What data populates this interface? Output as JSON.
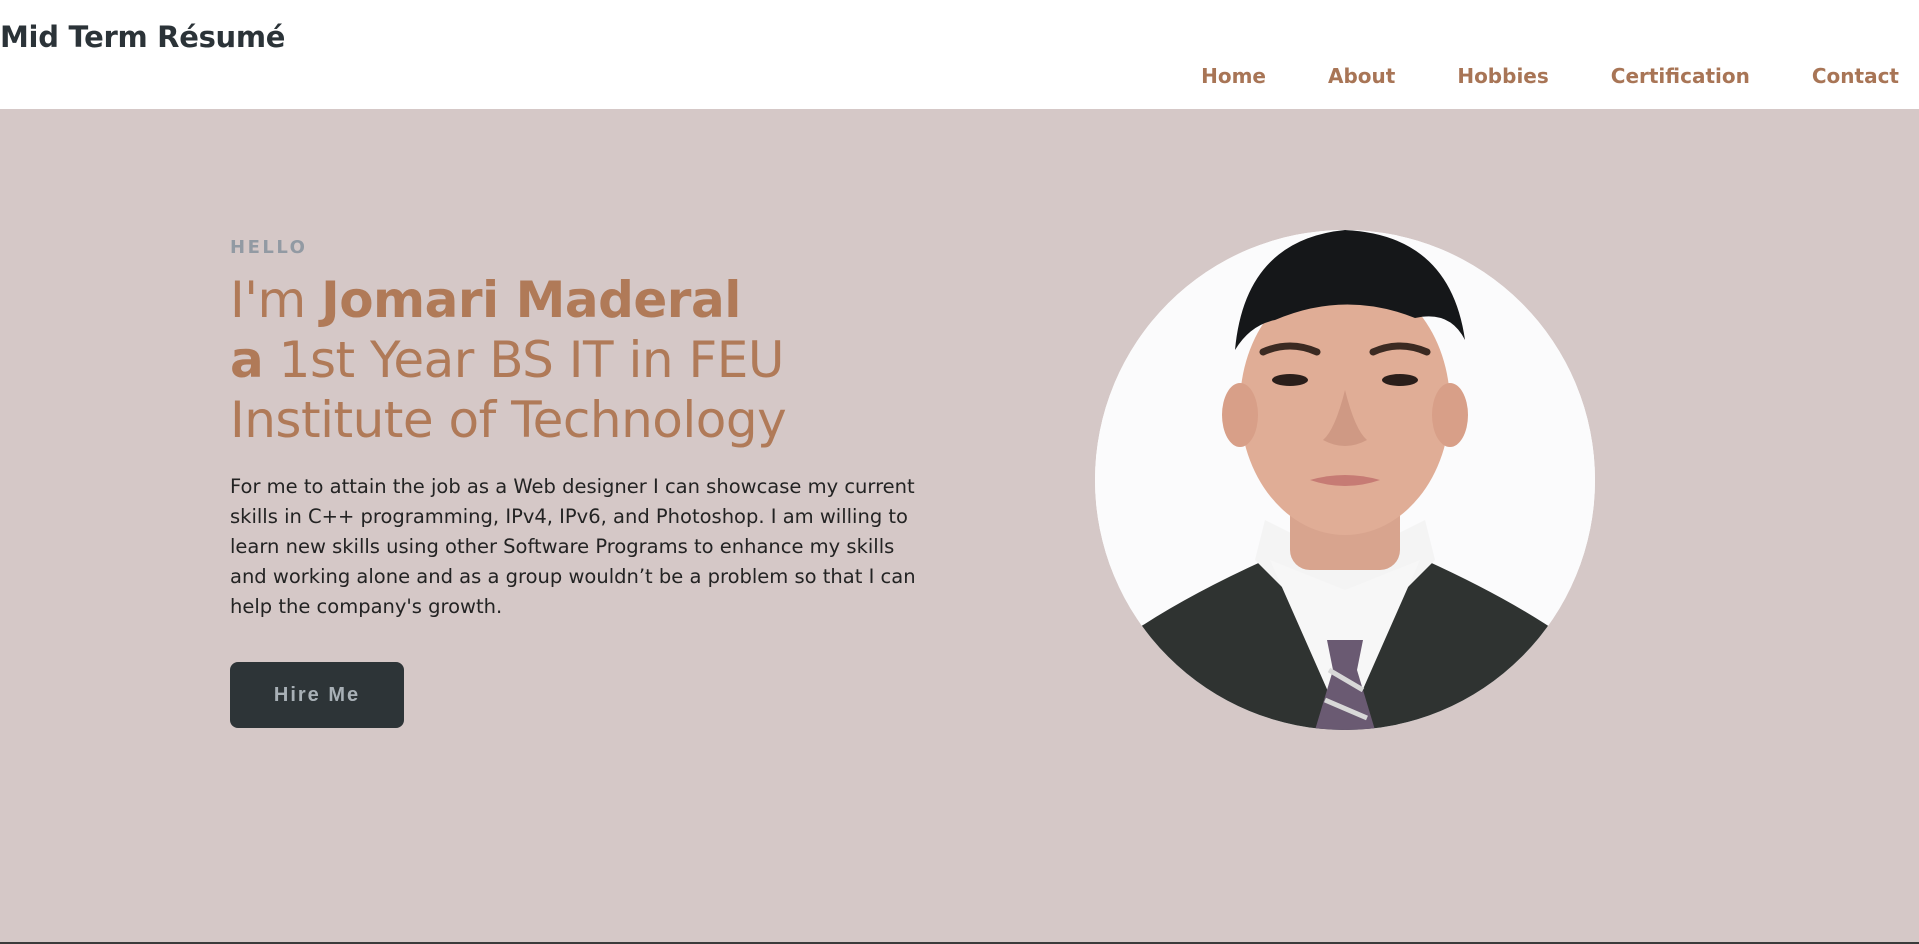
{
  "header": {
    "brand": "Mid Term Résumé",
    "nav": [
      "Home",
      "About",
      "Hobbies",
      "Certification",
      "Contact"
    ]
  },
  "hero": {
    "greeting": "HELLO",
    "headline_prefix": "I'm ",
    "name": "Jomari Maderal",
    "headline_a": "a",
    "headline_rest": " 1st Year BS IT in FEU Institute of Technology",
    "description": "For me to attain the job as a Web designer I can showcase my current skills in C++ programming, IPv4, IPv6, and Photoshop. I am willing to learn new skills using other Software Programs to enhance my skills and working alone and as a group wouldn’t be a problem so that I can help the company's growth.",
    "cta_label": "Hire Me",
    "portrait_icon": "profile-photo"
  },
  "colors": {
    "accent": "#b07a58",
    "hero_bg": "#d5c8c7",
    "button_bg": "#2d3437",
    "brand_text": "#2b3338"
  }
}
